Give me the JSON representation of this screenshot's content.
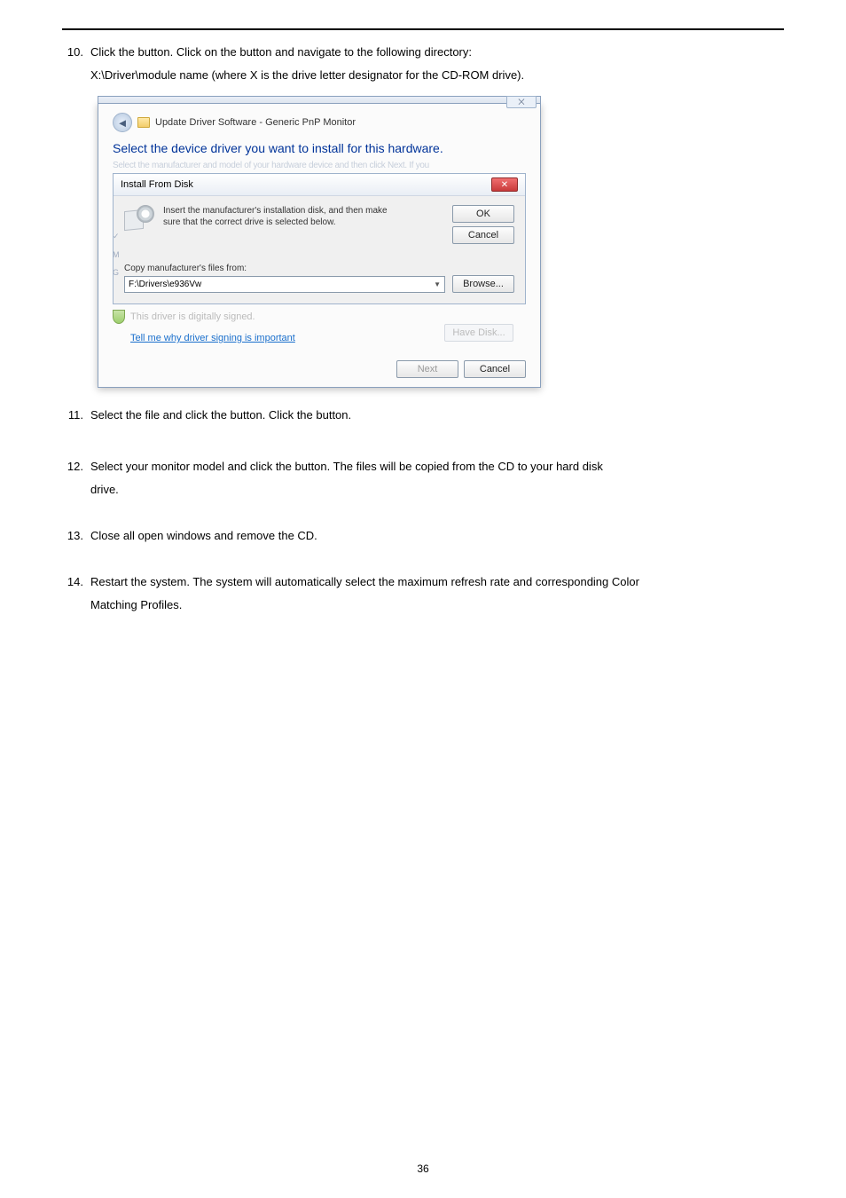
{
  "step10": {
    "num": "10.",
    "line1_pre": "Click the ",
    "line1_mid": " button. Click on the ",
    "line1_post": " button and navigate to the following directory:",
    "line2": "X:\\Driver\\module name (where X is the drive letter designator for the CD-ROM drive)."
  },
  "dialog": {
    "close_glyph": "⨉",
    "breadcrumb": "Update Driver Software - Generic PnP Monitor",
    "title": "Select the device driver you want to install for this hardware.",
    "sub_blur": "Select the manufacturer and model of your hardware device and then click Next. If you",
    "install_title": "Install From Disk",
    "install_msg_l1": "Insert the manufacturer's installation disk, and then make",
    "install_msg_l2": "sure that the correct drive is selected below.",
    "ok": "OK",
    "cancel": "Cancel",
    "side_v": "✓",
    "side_m": "M",
    "side_g": "G",
    "copy_label": "Copy manufacturer's files from:",
    "copy_value": "F:\\Drivers\\e936Vw",
    "browse": "Browse...",
    "signed_text": "This driver is digitally signed.",
    "have_disk": "Have Disk...",
    "link": "Tell me why driver signing is important",
    "next": "Next",
    "cancel2": "Cancel"
  },
  "step11": {
    "num": "11.",
    "p1": "Select the ",
    "p2": " file and click the ",
    "p3": " button. Click the ",
    "p4": " button."
  },
  "step12": {
    "num": "12.",
    "p1": "Select your monitor model and click the ",
    "p2": " button. The files will be copied from the CD to your hard disk",
    "p3": "drive."
  },
  "step13": {
    "num": "13.",
    "text": "Close all open windows and remove the CD."
  },
  "step14": {
    "num": "14.",
    "p1": "Restart the system. The system will automatically select the maximum refresh rate and corresponding Color",
    "p2": "Matching Profiles."
  },
  "footer": "36"
}
